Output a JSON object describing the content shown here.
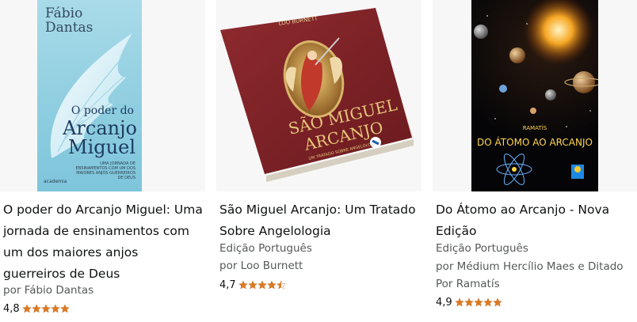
{
  "colors": {
    "star": "#de7921",
    "title": "#0f1111",
    "meta": "#565959"
  },
  "books": [
    {
      "title": "O poder do Arcanjo Miguel: Uma jornada de ensinamentos com um dos maiores anjos guerreiros de Deus",
      "author": "por Fábio Dantas",
      "rating": "4,8",
      "stars": 5,
      "cover": {
        "author_line1": "Fábio",
        "author_line2": "Dantas",
        "title_line1": "O poder do",
        "title_line2": "Arcanjo",
        "title_line3": "Miguel",
        "subtitle": "UMA JORNADA DE ENSINAMENTOS COM UM DOS MAIORES ANJOS GUERREIROS DE DEUS",
        "publisher": "academia"
      }
    },
    {
      "title": "São Miguel Arcanjo: Um Tratado Sobre Angelologia",
      "edition": "Edição Português",
      "author": "por Loo Burnett",
      "rating": "4,7",
      "stars": 4.5,
      "cover": {
        "author": "LOO BURNETT",
        "title_line1": "SÃO MIGUEL",
        "title_line2": "ARCANJO",
        "subtitle": "UM TRATADO SOBRE ANGELOLOGIA"
      }
    },
    {
      "title": "Do Átomo ao Arcanjo - Nova Edição",
      "edition": "Edição Português",
      "author": "por Médium Hercílio Maes e Ditado Por Ramatís",
      "rating": "4,9",
      "stars": 5,
      "cover": {
        "author": "RAMATÍS",
        "title": "DO ÁTOMO AO ARCANJO"
      }
    }
  ]
}
